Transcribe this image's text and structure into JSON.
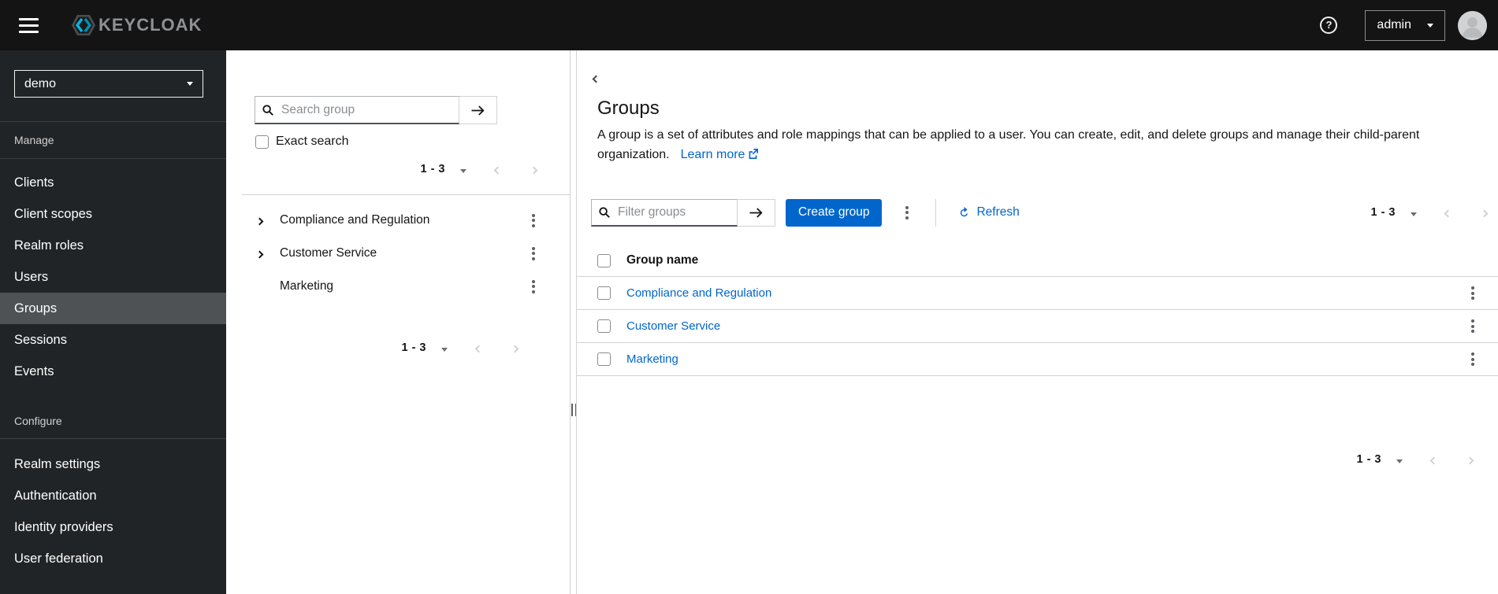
{
  "masthead": {
    "brand_text": "KEYCLOAK",
    "username": "admin"
  },
  "sidebar": {
    "realm": "demo",
    "sections": [
      {
        "label": "Manage",
        "items": [
          {
            "label": "Clients"
          },
          {
            "label": "Client scopes"
          },
          {
            "label": "Realm roles"
          },
          {
            "label": "Users"
          },
          {
            "label": "Groups"
          },
          {
            "label": "Sessions"
          },
          {
            "label": "Events"
          }
        ]
      },
      {
        "label": "Configure",
        "items": [
          {
            "label": "Realm settings"
          },
          {
            "label": "Authentication"
          },
          {
            "label": "Identity providers"
          },
          {
            "label": "User federation"
          }
        ]
      }
    ],
    "selected": "Groups"
  },
  "tree_panel": {
    "search_placeholder": "Search group",
    "exact_search_label": "Exact search",
    "pagination_top": "1 - 3",
    "pagination_bottom": "1 - 3",
    "groups": [
      {
        "name": "Compliance and Regulation",
        "expandable": true
      },
      {
        "name": "Customer Service",
        "expandable": true
      },
      {
        "name": "Marketing",
        "expandable": false
      }
    ]
  },
  "main": {
    "title": "Groups",
    "description": "A group is a set of attributes and role mappings that can be applied to a user. You can create, edit, and delete groups and manage their child-parent organization.",
    "learn_more_label": "Learn more",
    "toolbar": {
      "filter_placeholder": "Filter groups",
      "create_button_label": "Create group",
      "refresh_label": "Refresh",
      "pagination": "1 - 3"
    },
    "table": {
      "column_header": "Group name",
      "rows": [
        {
          "name": "Compliance and Regulation"
        },
        {
          "name": "Customer Service"
        },
        {
          "name": "Marketing"
        }
      ]
    },
    "pagination_bottom": "1 - 3"
  },
  "colors": {
    "masthead_bg": "#141414",
    "sidebar_bg": "#212427",
    "sidebar_selected_bg": "#4f5255",
    "primary_blue": "#0066cc",
    "link_blue": "#0066cc",
    "border_gray": "#d2d2d2"
  }
}
